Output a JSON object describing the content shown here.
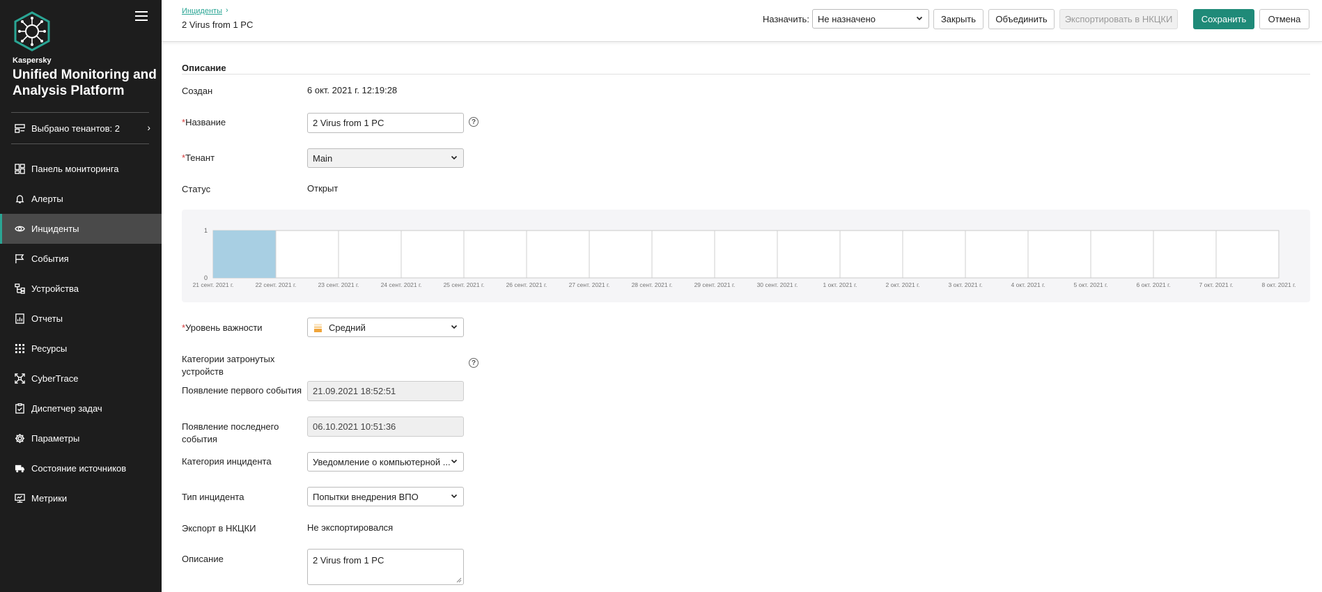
{
  "sidebar": {
    "brand_small": "Kaspersky",
    "brand_title": "Unified Monitoring and Analysis Platform",
    "tenant_selector": "Выбрано тенантов: 2",
    "items": [
      {
        "label": "Панель мониторинга",
        "icon": "dashboard-icon"
      },
      {
        "label": "Алерты",
        "icon": "bell-icon"
      },
      {
        "label": "Инциденты",
        "icon": "eye-icon",
        "active": true
      },
      {
        "label": "События",
        "icon": "flag-icon"
      },
      {
        "label": "Устройства",
        "icon": "devices-icon"
      },
      {
        "label": "Отчеты",
        "icon": "report-icon"
      },
      {
        "label": "Ресурсы",
        "icon": "grid-icon"
      },
      {
        "label": "CyberTrace",
        "icon": "cybertrace-icon"
      },
      {
        "label": "Диспетчер задач",
        "icon": "clipboard-icon"
      },
      {
        "label": "Параметры",
        "icon": "gear-icon"
      },
      {
        "label": "Состояние источников",
        "icon": "truck-icon"
      },
      {
        "label": "Метрики",
        "icon": "monitor-icon"
      }
    ]
  },
  "header": {
    "breadcrumb": "Инциденты",
    "title": "2 Virus from 1 PC",
    "assign_label": "Назначить:",
    "assign_value": "Не назначено",
    "close_label": "Закрыть",
    "merge_label": "Объединить",
    "export_label": "Экспортировать в НКЦКИ",
    "save_label": "Сохранить",
    "cancel_label": "Отмена"
  },
  "form": {
    "section_title": "Описание",
    "created_label": "Создан",
    "created_value": "6 окт. 2021 г. 12:19:28",
    "name_label": "Название",
    "name_value": "2 Virus from 1 PC",
    "tenant_label": "Тенант",
    "tenant_value": "Main",
    "status_label": "Статус",
    "status_value": "Открыт",
    "severity_label": "Уровень важности",
    "severity_value": "Средний",
    "device_cat_label": "Категории затронутых устройств",
    "first_event_label": "Появление первого события",
    "first_event_value": "21.09.2021 18:52:51",
    "last_event_label": "Появление последнего события",
    "last_event_value": "06.10.2021 10:51:36",
    "incident_cat_label": "Категория инцидента",
    "incident_cat_value": "Уведомление о компьютерной ...",
    "incident_type_label": "Тип инцидента",
    "incident_type_value": "Попытки внедрения ВПО",
    "export_label": "Экспорт в НКЦКИ",
    "export_value": "Не экспортировался",
    "description_label": "Описание",
    "description_value": "2 Virus from 1 PC"
  },
  "colors": {
    "accent": "#2aa594",
    "primary_button": "#1f8a78",
    "bar": "#a8cfe3",
    "severity": "#f0a43a"
  },
  "chart_data": {
    "type": "bar",
    "categories": [
      "21 сент. 2021 г.",
      "22 сент. 2021 г.",
      "23 сент. 2021 г.",
      "24 сент. 2021 г.",
      "25 сент. 2021 г.",
      "26 сент. 2021 г.",
      "27 сент. 2021 г.",
      "28 сент. 2021 г.",
      "29 сент. 2021 г.",
      "30 сент. 2021 г.",
      "1 окт. 2021 г.",
      "2 окт. 2021 г.",
      "3 окт. 2021 г.",
      "4 окт. 2021 г.",
      "5 окт. 2021 г.",
      "6 окт. 2021 г.",
      "7 окт. 2021 г.",
      "8 окт. 2021 г."
    ],
    "values": [
      1,
      0,
      0,
      0,
      0,
      0,
      0,
      0,
      0,
      0,
      0,
      0,
      0,
      0,
      0,
      0,
      0
    ],
    "y_ticks": [
      "0",
      "1"
    ],
    "ylim": [
      0,
      1
    ],
    "title": "",
    "xlabel": "",
    "ylabel": "",
    "grid": true
  }
}
